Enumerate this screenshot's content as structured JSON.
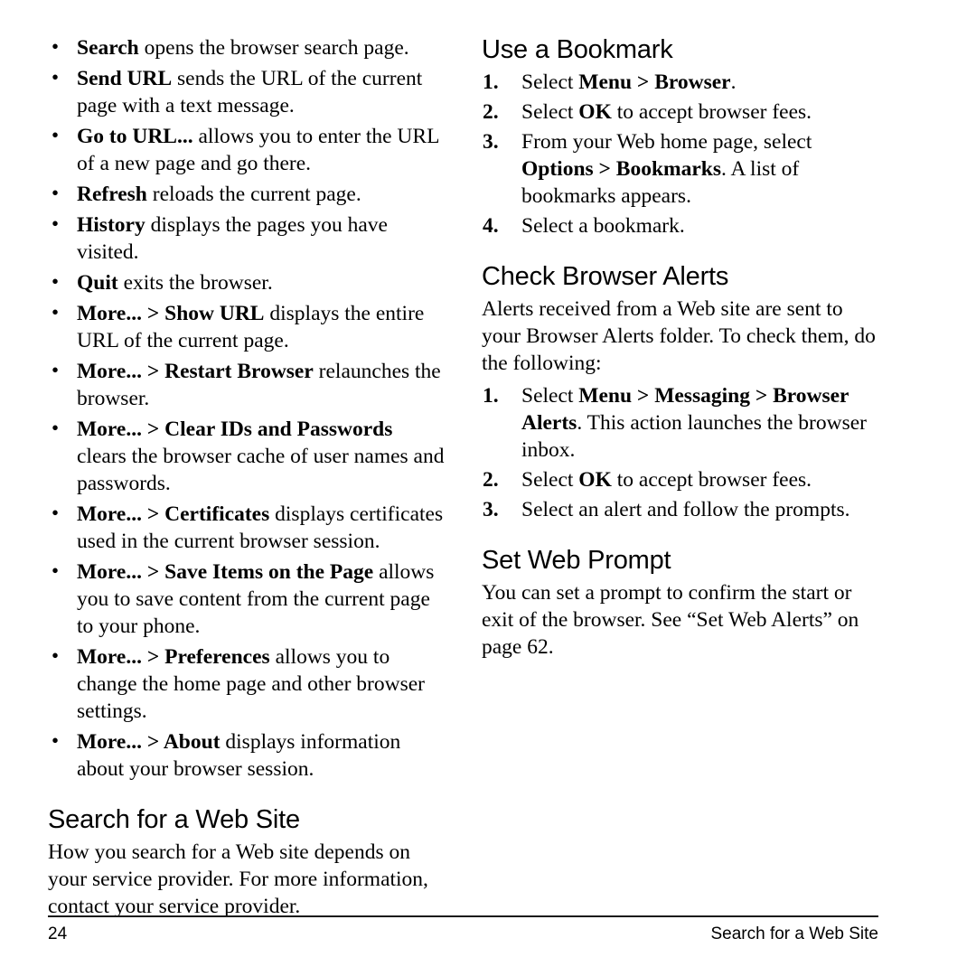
{
  "page": {
    "number": "24",
    "running_head": "Search for a Web Site"
  },
  "left_column": {
    "menu_bullets": [
      {
        "bold": "Search",
        "rest": " opens the browser search page."
      },
      {
        "bold": "Send URL",
        "rest": " sends the URL of the current page with a text message."
      },
      {
        "bold": "Go to URL...",
        "rest": " allows you to enter the URL of a new page and go there."
      },
      {
        "bold": "Refresh",
        "rest": " reloads the current page."
      },
      {
        "bold": "History",
        "rest": " displays the pages you have visited."
      },
      {
        "bold": "Quit",
        "rest": " exits the browser."
      },
      {
        "bold": "More... > Show URL",
        "rest": " displays the entire URL of the current page."
      },
      {
        "bold": "More... > Restart Browser",
        "rest": " relaunches the browser."
      },
      {
        "bold": "More... > Clear IDs and Passwords",
        "rest": " clears the browser cache of user names and passwords."
      },
      {
        "bold": "More... > Certificates",
        "rest": " displays certificates used in the current browser session."
      },
      {
        "bold": "More... > Save Items on the Page",
        "rest": " allows you to save content from the current page to your phone."
      },
      {
        "bold": "More... > Preferences",
        "rest": " allows you to change the home page and other browser settings."
      },
      {
        "bold": "More... > About",
        "rest": " displays information about your browser session."
      }
    ],
    "search_section": {
      "heading": "Search for a Web Site",
      "paragraph": "How you search for a Web site depends on your service provider. For more information, contact your service provider."
    }
  },
  "right_column": {
    "bookmark_section": {
      "heading": "Use a Bookmark",
      "steps": [
        {
          "num": "1.",
          "pre": "Select ",
          "bold": "Menu  > Browser",
          "post": "."
        },
        {
          "num": "2.",
          "pre": "Select ",
          "bold": "OK",
          "post": " to accept browser fees."
        },
        {
          "num": "3.",
          "pre": "From your Web home page, select ",
          "bold": "Options > Bookmarks",
          "post": ". A list of bookmarks appears."
        },
        {
          "num": "4.",
          "pre": "Select a bookmark.",
          "bold": "",
          "post": ""
        }
      ]
    },
    "alerts_section": {
      "heading": "Check Browser Alerts",
      "paragraph": "Alerts received from a Web site are sent to your Browser Alerts folder. To check them, do the following:",
      "steps": [
        {
          "num": "1.",
          "pre": "Select ",
          "bold": "Menu  > Messaging > Browser Alerts",
          "post": ". This action launches the browser inbox."
        },
        {
          "num": "2.",
          "pre": "Select ",
          "bold": "OK",
          "post": " to accept browser fees."
        },
        {
          "num": "3.",
          "pre": "Select an alert and follow the prompts.",
          "bold": "",
          "post": ""
        }
      ]
    },
    "prompt_section": {
      "heading": "Set Web Prompt",
      "paragraph": "You can set a prompt to confirm the start or exit of the browser. See “Set Web Alerts” on page 62."
    }
  }
}
